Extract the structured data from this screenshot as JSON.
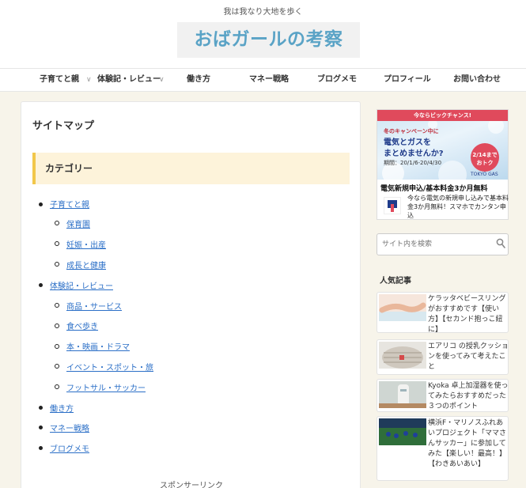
{
  "header": {
    "tagline": "我は我なり大地を歩く",
    "site_title": "おばガールの考察"
  },
  "nav": {
    "items": [
      "子育てと親",
      "体験記・レビュー",
      "働き方",
      "マネー戦略",
      "ブログメモ",
      "プロフィール",
      "お問い合わせ"
    ],
    "arrows": [
      "∨",
      "∨"
    ]
  },
  "main": {
    "page_title": "サイトマップ",
    "category_heading": "カテゴリー",
    "categories": [
      {
        "label": "子育てと親",
        "children": [
          "保育園",
          "妊娠・出産",
          "成長と健康"
        ]
      },
      {
        "label": "体験記・レビュー",
        "children": [
          "商品・サービス",
          "食べ歩き",
          "本・映画・ドラマ",
          "イベント・スポット・旅",
          "フットサル・サッカー"
        ]
      },
      {
        "label": "働き方",
        "children": []
      },
      {
        "label": "マネー戦略",
        "children": []
      },
      {
        "label": "ブログメモ",
        "children": []
      }
    ],
    "sponsor_label": "スポンサーリンク"
  },
  "ad": {
    "top_strip": "今ならビックチャンス!",
    "line1": "冬のキャンペーン中に",
    "line2": "電気とガスを",
    "line3": "まとめませんか?",
    "period": "期間：20/1/6-20/4/30",
    "badge": "2/14まで おトク",
    "brand": "TOKYO GAS",
    "headline": "電気新規申込/基本料金3か月無料",
    "description": "今なら電気の新規申し込みで基本料金3か月無料！スマホでカンタン申込"
  },
  "search": {
    "placeholder": "サイト内を検索"
  },
  "sidebar": {
    "popular_title": "人気記事",
    "popular": [
      "ケラッタベビースリングがおすすめです【使い方】【セカンド抱っこ紐に】",
      "エアリコ の授乳クッションを使ってみて考えたこと",
      "Kyoka 卓上加湿器を使ってみたらおすすめだった３つのポイント",
      "横浜F・マリノスふれあいプロジェクト「ママさんサッカー」に参加してみた【楽しい！最高！】【わきあいあい】"
    ]
  },
  "colors": {
    "site_title": "#5aa3c6",
    "link": "#2b6fc7",
    "category_accent": "#f2c74a",
    "category_bg": "#fdf3da",
    "page_bg": "#f7f4ea"
  }
}
